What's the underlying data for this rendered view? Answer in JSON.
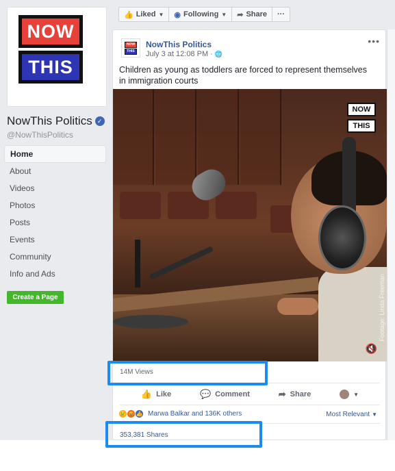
{
  "page": {
    "name": "NowThis Politics",
    "handle": "@NowThisPolitics",
    "logo_top": "NOW",
    "logo_bottom": "THIS"
  },
  "sidebar": {
    "items": [
      {
        "label": "Home",
        "active": true
      },
      {
        "label": "About"
      },
      {
        "label": "Videos"
      },
      {
        "label": "Photos"
      },
      {
        "label": "Posts"
      },
      {
        "label": "Events"
      },
      {
        "label": "Community"
      },
      {
        "label": "Info and Ads"
      }
    ],
    "create_page": "Create a Page"
  },
  "actions": {
    "liked": "Liked",
    "following": "Following",
    "share": "Share",
    "more": "···"
  },
  "post": {
    "author": "NowThis Politics",
    "time": "July 3 at 12:08 PM ·",
    "more": "•••",
    "text": "Children as young as toddlers are forced to represent themselves in immigration courts",
    "video_logo_top": "NOW",
    "video_logo_bottom": "THIS",
    "credit": "Footage: Linda Freeman",
    "views": "14M Views",
    "buttons": {
      "like": "Like",
      "comment": "Comment",
      "share": "Share"
    },
    "reactions_text": "Marwa Balkar and 136K others",
    "sort": "Most Relevant",
    "shares": "353,381 Shares"
  },
  "colors": {
    "brand_red": "#e8413a",
    "brand_blue": "#2d35b5",
    "fb_link": "#365899",
    "highlight": "#1a8cf0",
    "create_green": "#42b72a"
  }
}
